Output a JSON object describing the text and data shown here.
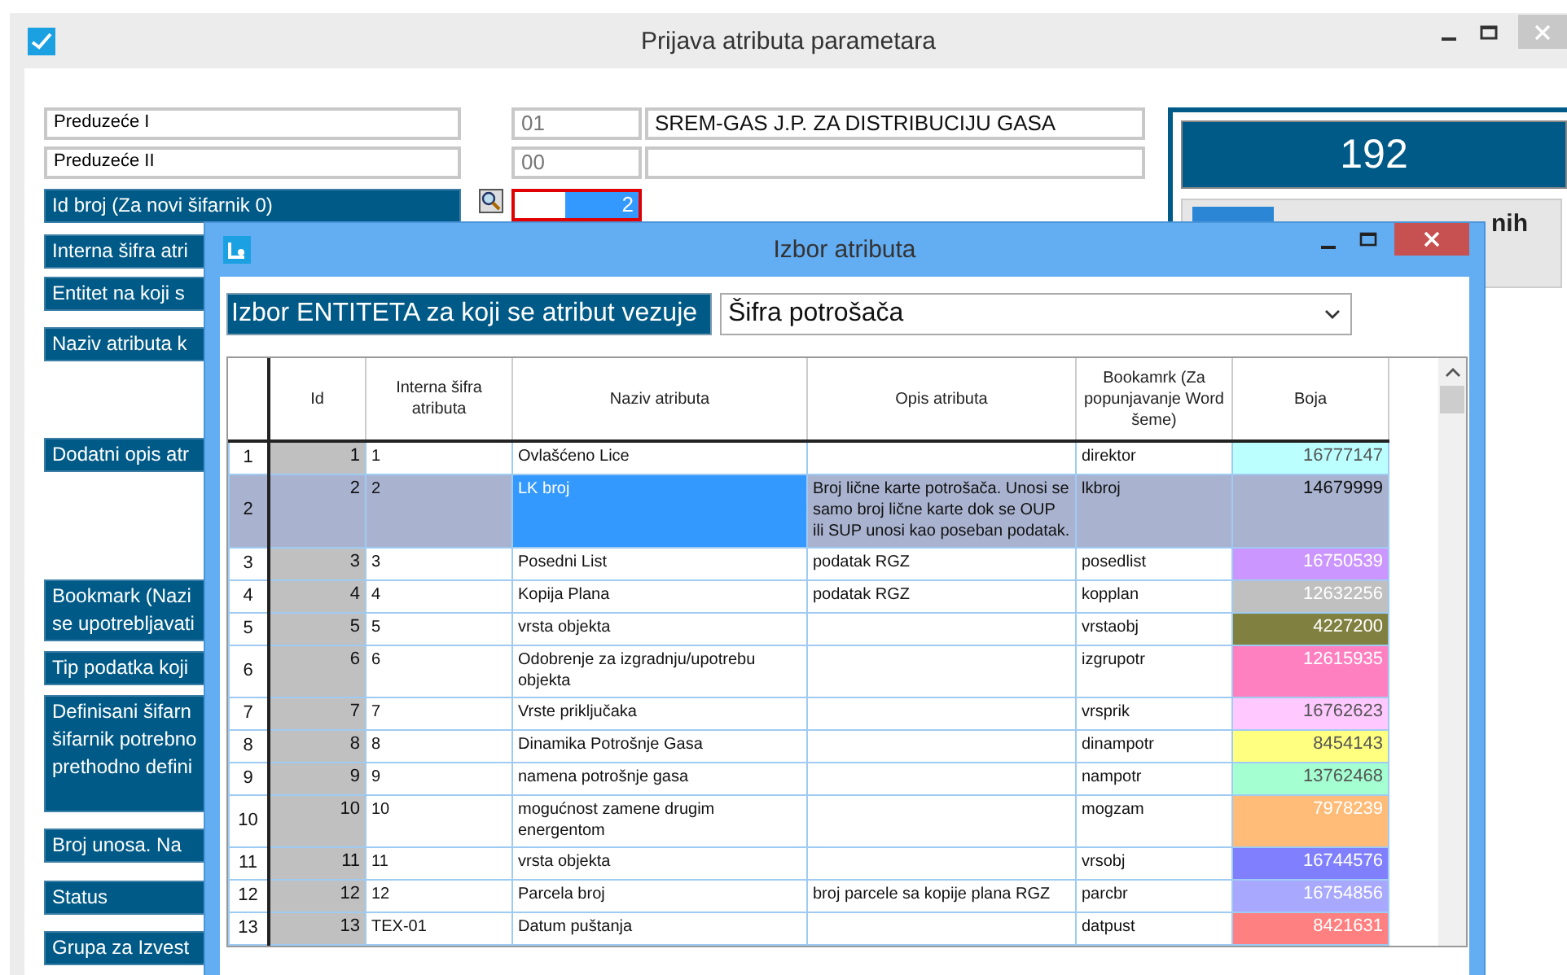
{
  "window": {
    "title": "Prijava atributa parametara"
  },
  "company_rows": [
    {
      "name": "Preduzeće I",
      "code": "01",
      "title": "SREM-GAS J.P. ZA DISTRIBUCIJU GASA"
    },
    {
      "name": "Preduzeće II",
      "code": "00",
      "title": ""
    }
  ],
  "id_row": {
    "label": "Id broj (Za novi šifarnik 0)",
    "value": "2"
  },
  "labels": [
    "Interna šifra atri",
    "Entitet na koji s",
    "Naziv atributa k",
    "Dodatni opis atr",
    "Bookmark (Nazi\nse upotrebljavati",
    "Tip podatka koji",
    "Definisani šifarn\nšifarnik potrebno\nprethodno defini",
    "Broj unosa. Na",
    "Status",
    "Grupa za Izvest"
  ],
  "counter": "192",
  "side_button": {
    "label": "nih"
  },
  "dialog": {
    "title": "Izbor atributa",
    "entity_label": "Izbor ENTITETA za koji se atribut vezuje",
    "entity_select": "Šifra potrošača",
    "table": {
      "columns": [
        "Id",
        "Interna šifra atributa",
        "Naziv atributa",
        "Opis atributa",
        "Bookamrk (Za popunjavanje Word šeme)",
        "Boja"
      ],
      "rows": [
        {
          "num": "1",
          "id": "1",
          "code": "1",
          "name": "Ovlašćeno Lice",
          "desc": "",
          "bookmark": "direktor",
          "boja": "16777147",
          "color": "#bbffff",
          "selected": false
        },
        {
          "num": "2",
          "id": "2",
          "code": "2",
          "name": "LK broj",
          "desc": "Broj lične karte potrošača. Unosi se samo broj lične karte dok se OUP ili SUP unosi kao poseban podatak.",
          "bookmark": "lkbroj",
          "boja": "14679999",
          "selected": true
        },
        {
          "num": "3",
          "id": "3",
          "code": "3",
          "name": "Posedni List",
          "desc": "podatak RGZ",
          "bookmark": "posedlist",
          "boja": "16750539",
          "color": "#cb96ff",
          "selected": false
        },
        {
          "num": "4",
          "id": "4",
          "code": "4",
          "name": "Kopija Plana",
          "desc": "podatak RGZ",
          "bookmark": "kopplan",
          "boja": "12632256",
          "color": "#c0c0c0",
          "selected": false
        },
        {
          "num": "5",
          "id": "5",
          "code": "5",
          "name": "vrsta objekta",
          "desc": "",
          "bookmark": "vrstaobj",
          "boja": "4227200",
          "color": "#808040",
          "selected": false
        },
        {
          "num": "6",
          "id": "6",
          "code": "6",
          "name": "Odobrenje za izgradnju/upotrebu objekta",
          "desc": "",
          "bookmark": "izgrupotr",
          "boja": "12615935",
          "color": "#ff80c0",
          "selected": false
        },
        {
          "num": "7",
          "id": "7",
          "code": "7",
          "name": "Vrste priključaka",
          "desc": "",
          "bookmark": "vrsprik",
          "boja": "16762623",
          "color": "#ffc8ff",
          "selected": false
        },
        {
          "num": "8",
          "id": "8",
          "code": "8",
          "name": "Dinamika Potrošnje Gasa",
          "desc": "",
          "bookmark": "dinampotr",
          "boja": "8454143",
          "color": "#ffff80",
          "selected": false
        },
        {
          "num": "9",
          "id": "9",
          "code": "9",
          "name": "namena potrošnje gasa",
          "desc": "",
          "bookmark": "nampotr",
          "boja": "13762468",
          "color": "#a4ffd1",
          "selected": false
        },
        {
          "num": "10",
          "id": "10",
          "code": "10",
          "name": "mogućnost zamene drugim energentom",
          "desc": "",
          "bookmark": "mogzam",
          "boja": "7978239",
          "color": "#ffbc79",
          "selected": false
        },
        {
          "num": "11",
          "id": "11",
          "code": "11",
          "name": "vrsta objekta",
          "desc": "",
          "bookmark": "vrsobj",
          "boja": "16744576",
          "color": "#8080ff",
          "selected": false
        },
        {
          "num": "12",
          "id": "12",
          "code": "12",
          "name": "Parcela broj",
          "desc": "broj parcele sa kopije plana RGZ",
          "bookmark": "parcbr",
          "boja": "16754856",
          "color": "#a8a8ff",
          "selected": false
        },
        {
          "num": "13",
          "id": "13",
          "code": "TEX-01",
          "name": "Datum puštanja",
          "desc": "",
          "bookmark": "datpust",
          "boja": "8421631",
          "color": "#ff8080",
          "selected": false
        }
      ]
    }
  }
}
